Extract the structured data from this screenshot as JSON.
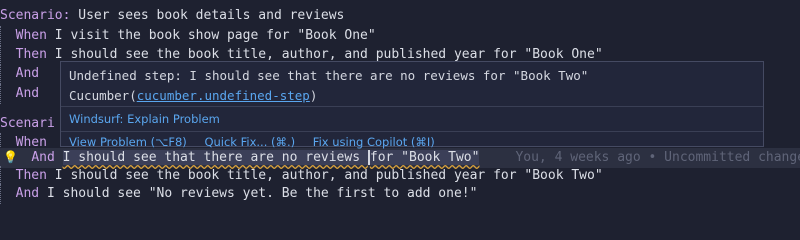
{
  "editor": {
    "lines": [
      {
        "kw": "Scenario:",
        "text": " User sees book details and reviews",
        "indent": ""
      },
      {
        "kw": "When",
        "text": " I visit the book show page for \"Book One\"",
        "indent": "  "
      },
      {
        "kw": "Then",
        "text": " I should see the book title, author, and published year for \"Book One\"",
        "indent": "  "
      },
      {
        "kw": "And",
        "text": "",
        "indent": "  "
      },
      {
        "kw": "And",
        "text": "",
        "indent": "  "
      },
      {
        "kw": "",
        "text": "",
        "indent": ""
      },
      {
        "kw": "Scenari",
        "text": "",
        "indent": ""
      },
      {
        "kw": "When",
        "text": "",
        "indent": "  "
      },
      {
        "kw": "And",
        "text": "",
        "indent": "  "
      },
      {
        "kw": "Then",
        "text": " I should see the book title, author, and published year for \"Book Two\"",
        "indent": "  "
      },
      {
        "kw": "And",
        "text": " I should see \"No reviews yet. Be the first to add one!\"",
        "indent": "  "
      }
    ],
    "active_line": {
      "kw": "And",
      "text_before_cursor": "I should see that there are no reviews ",
      "text_after_cursor": "for \"Book Two\"",
      "blame": "You, 4 weeks ago • Uncommitted changes"
    }
  },
  "hover": {
    "message": "Undefined step: I should see that there are no reviews for \"Book Two\" Cucumber(",
    "code_link": "cucumber.undefined-step",
    "message_end": ")",
    "explain": "Windsurf: Explain Problem",
    "view_problem": "View Problem (⌥F8)",
    "quick_fix": "Quick Fix... (⌘.)",
    "copilot_fix": "Fix using Copilot (⌘I)"
  },
  "colors": {
    "keyword": "#c9a0e8",
    "link": "#5aa6ef",
    "background": "#1e2130",
    "squiggle": "#d9a13b"
  }
}
